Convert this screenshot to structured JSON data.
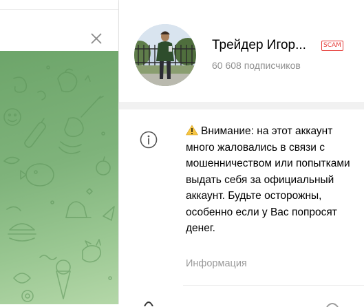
{
  "left": {
    "close_icon": "close-icon",
    "wallpaper": "doodle-pattern-wallpaper",
    "wallpaper_color": "#7fb37b"
  },
  "profile": {
    "name": "Трейдер Игор...",
    "badge": "SCAM",
    "badge_color": "#e53935",
    "subscribers": "60 608 подписчиков"
  },
  "info": {
    "icon": "info-icon",
    "warning_icon": "warning-icon",
    "warning_text": "Внимание: на этот аккаунт много жаловались в связи с мошенничеством или попытками выдать себя за официальный аккаунт. Будьте осторожны, особенно если у Вас попросят денег.",
    "label": "Информация"
  }
}
